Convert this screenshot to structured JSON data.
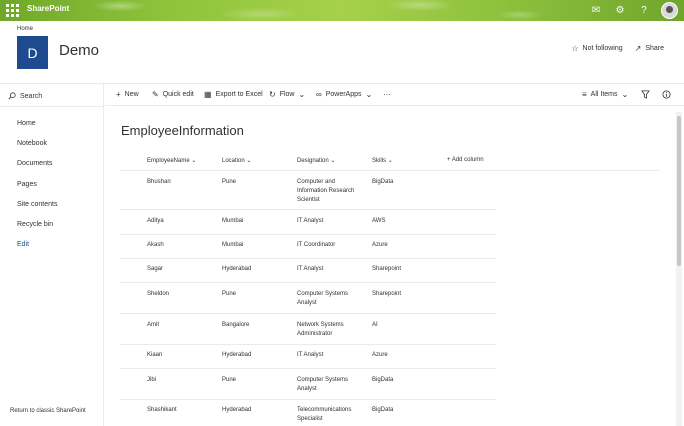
{
  "suitebar": {
    "app_name": "SharePoint",
    "icons": [
      "bell-icon",
      "gear-icon",
      "help-icon"
    ]
  },
  "site": {
    "breadcrumb": "Home",
    "logo_letter": "D",
    "title": "Demo",
    "follow_label": "Not following",
    "share_label": "Share"
  },
  "leftnav": {
    "search_label": "Search",
    "items": [
      "Home",
      "Notebook",
      "Documents",
      "Pages",
      "Site contents",
      "Recycle bin",
      "Edit"
    ],
    "return_label": "Return to classic SharePoint"
  },
  "commandbar": {
    "new_label": "New",
    "quick_edit_label": "Quick edit",
    "export_label": "Export to Excel",
    "flow_label": "Flow",
    "powerapps_label": "PowerApps",
    "view_label": "All Items"
  },
  "list": {
    "title": "EmployeeInformation",
    "columns": [
      "EmployeeName",
      "Location",
      "Designation",
      "Skills"
    ],
    "add_column_label": "+ Add column",
    "rows": [
      {
        "name": "Bhushan",
        "location": "Pune",
        "designation": "Computer and Information Research Scientist",
        "skills": "BigData"
      },
      {
        "name": "Aditya",
        "location": "Mumbai",
        "designation": "IT Analyst",
        "skills": "AWS"
      },
      {
        "name": "Akash",
        "location": "Mumbai",
        "designation": "IT Coordinator",
        "skills": "Azure"
      },
      {
        "name": "Sagar",
        "location": "Hyderabad",
        "designation": "IT Analyst",
        "skills": "Sharepoint"
      },
      {
        "name": "Sheldon",
        "location": "Pune",
        "designation": "Computer Systems Analyst",
        "skills": "Sharepoint"
      },
      {
        "name": "Amit",
        "location": "Bangalore",
        "designation": "Network Systems Administrator",
        "skills": "AI"
      },
      {
        "name": "Kiaan",
        "location": "Hyderabad",
        "designation": "IT Analyst",
        "skills": "Azure"
      },
      {
        "name": "Jibi",
        "location": "Pune",
        "designation": "Computer Systems Analyst",
        "skills": "BigData"
      },
      {
        "name": "Shashikant",
        "location": "Hyderabad",
        "designation": "Telecommunications Specialist",
        "skills": "BigData"
      }
    ]
  },
  "colors": {
    "suitebar_green": "#8fc43a",
    "brand_blue": "#1e4b8f",
    "divider": "#edebe9"
  }
}
